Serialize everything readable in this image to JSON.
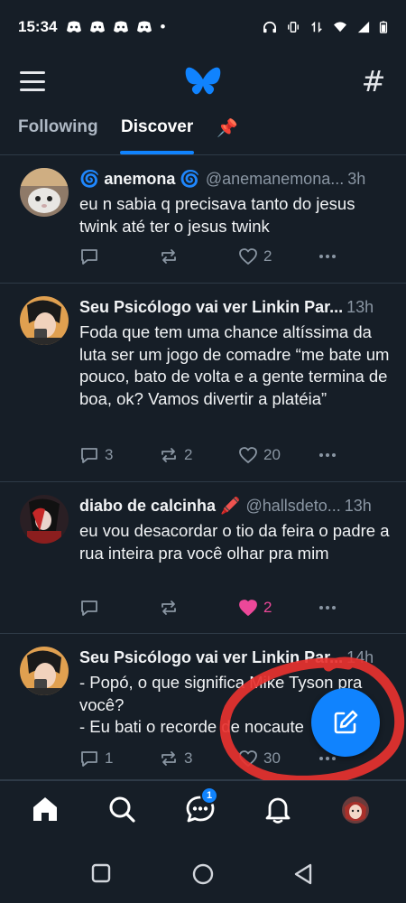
{
  "status_bar": {
    "time": "15:34",
    "dot": "•"
  },
  "top_bar": {
    "hash_symbol": "#"
  },
  "tabs": [
    {
      "label": "Following",
      "active": false
    },
    {
      "label": "Discover",
      "active": true
    },
    {
      "label": "📌",
      "active": false
    }
  ],
  "posts": [
    {
      "author": "🌀 anemona 🌀",
      "handle": "@anemanemona...",
      "time": "3h",
      "text": "eu n sabia q precisava tanto do jesus twink até ter o jesus twink",
      "replies": "",
      "reposts": "",
      "likes": "2",
      "liked": false
    },
    {
      "author": "Seu Psicólogo vai ver Linkin Par...",
      "handle": "",
      "time": "13h",
      "text": "Foda que tem uma chance altíssima da luta ser um jogo de comadre “me bate um pouco, bato de volta e a gente termina de boa, ok? Vamos divertir a platéia”",
      "replies": "3",
      "reposts": "2",
      "likes": "20",
      "liked": false
    },
    {
      "author": "diabo de calcinha 🖍️",
      "handle": "@hallsdeto...",
      "time": "13h",
      "text": "eu vou desacordar o tio da feira o padre a rua inteira pra você olhar pra mim",
      "replies": "",
      "reposts": "",
      "likes": "2",
      "liked": true
    },
    {
      "author": "Seu Psicólogo vai ver Linkin Par...",
      "handle": "",
      "time": "14h",
      "text_lines": [
        "- Popó, o que significa Mike Tyson pra você?",
        "- Eu bati o recorde de nocaute"
      ],
      "replies": "1",
      "reposts": "3",
      "likes": "30",
      "liked": false
    }
  ],
  "bottom_nav": {
    "messages_badge": "1"
  },
  "colors": {
    "background": "#161e27",
    "accent": "#1083fe",
    "like": "#ec4899",
    "annotation": "#e8322f"
  }
}
